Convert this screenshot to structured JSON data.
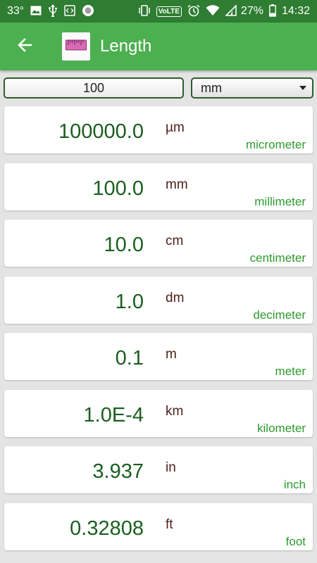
{
  "status_bar": {
    "temperature": "33°",
    "battery": "27%",
    "time": "14:32",
    "volte": "VoLTE"
  },
  "app_bar": {
    "title": "Length",
    "back_icon": "arrow-back-icon",
    "app_icon": "ruler-icon"
  },
  "converter": {
    "input_value": "100",
    "selected_unit": "mm"
  },
  "results": [
    {
      "value": "100000.0",
      "symbol": "µm",
      "name": "micrometer"
    },
    {
      "value": "100.0",
      "symbol": "mm",
      "name": "millimeter"
    },
    {
      "value": "10.0",
      "symbol": "cm",
      "name": "centimeter"
    },
    {
      "value": "1.0",
      "symbol": "dm",
      "name": "decimeter"
    },
    {
      "value": "0.1",
      "symbol": "m",
      "name": "meter"
    },
    {
      "value": "1.0E-4",
      "symbol": "km",
      "name": "kilometer"
    },
    {
      "value": "3.937",
      "symbol": "in",
      "name": "inch"
    },
    {
      "value": "0.32808",
      "symbol": "ft",
      "name": "foot"
    }
  ],
  "colors": {
    "status_bar": "#2e7d32",
    "app_bar": "#4caf50",
    "value_text": "#1b5e20",
    "unit_name": "#2e9a2e"
  }
}
